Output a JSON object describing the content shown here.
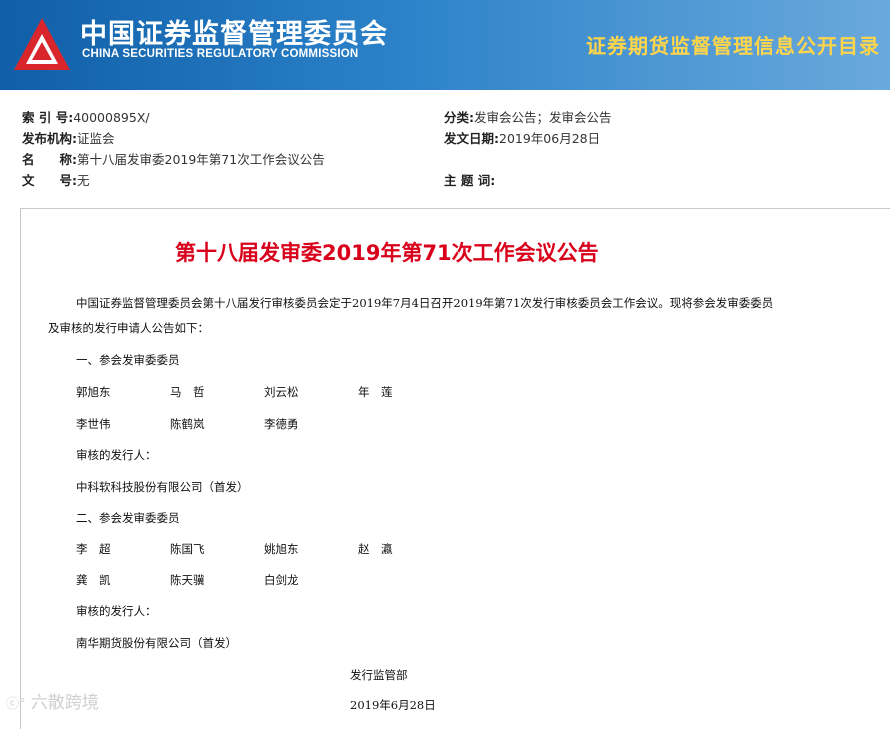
{
  "header": {
    "org_name_cn": "中国证券监督管理委员会",
    "org_name_en": "CHINA SECURITIES REGULATORY COMMISSION",
    "section_title": "证券期货监督管理信息公开目录"
  },
  "meta": {
    "index_label": "索 引 号:",
    "index_value": "40000895X/",
    "publisher_label": "发布机构:",
    "publisher_value": "证监会",
    "name_label": "名　　称:",
    "name_value": "第十八届发审委2019年第71次工作会议公告",
    "docno_label": "文　　号:",
    "docno_value": "无",
    "category_label": "分类:",
    "category_value": "发审会公告；发审会公告",
    "date_label": "发文日期:",
    "date_value": "2019年06月28日",
    "keywords_label": "主 题 词:",
    "keywords_value": ""
  },
  "doc": {
    "title": "第十八届发审委2019年第71次工作会议公告",
    "intro_line1": "中国证券监督管理委员会第十八届发行审核委员会定于2019年7月4日召开2019年第71次发行审核委员会工作会议。现将参会发审委委员",
    "intro_line2": "及审核的发行申请人公告如下：",
    "section1_title": "一、参会发审委委员",
    "section1_members_row1": [
      "郭旭东",
      "马　哲",
      "刘云松",
      "年　莲"
    ],
    "section1_members_row2": [
      "李世伟",
      "陈鹤岚",
      "李德勇"
    ],
    "section1_applicant_label": "审核的发行人：",
    "section1_applicant": "中科软科技股份有限公司（首发）",
    "section2_title": "二、参会发审委委员",
    "section2_members_row1": [
      "李　超",
      "陈国飞",
      "姚旭东",
      "赵　瀛"
    ],
    "section2_members_row2": [
      "龚　凯",
      "陈天骥",
      "白剑龙"
    ],
    "section2_applicant_label": "审核的发行人：",
    "section2_applicant": "南华期货股份有限公司（首发）",
    "signature": "发行监管部",
    "signature_date": "2019年6月28日"
  },
  "watermark": "六散跨境",
  "colors": {
    "banner_blue": "#0f5fa8",
    "logo_red": "#d9262c",
    "section_title_yellow": "#ffd54a",
    "doc_title_red": "#d9001b"
  }
}
